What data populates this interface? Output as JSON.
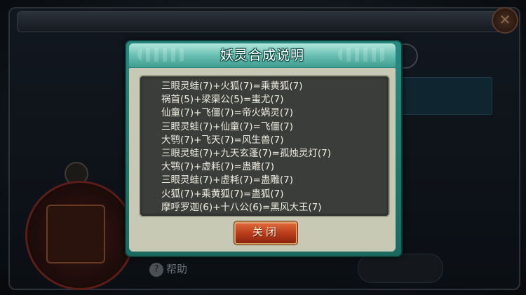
{
  "background": {
    "help_label": "帮助"
  },
  "dialog": {
    "title": "妖灵合成说明",
    "recipes": [
      "三眼灵蛙(7)+火狐(7)=乘黄狐(7)",
      "祸首(5)+梁渠公(5)=蚩尤(7)",
      "仙童(7)+飞僵(7)=帝火娲灵(7)",
      "三眼灵蛙(7)+仙童(7)=飞僵(7)",
      "大鹗(7)+飞天(7)=风生兽(7)",
      "三眼灵蛙(7)+九天玄蓬(7)=孤烛灵灯(7)",
      "大鹗(7)+虚耗(7)=蛊雕(7)",
      "三眼灵蛙(7)+虚耗(7)=蛊雕(7)",
      "火狐(7)+乘黄狐(7)=蛊狐(7)",
      "摩呼罗迦(6)+十八公(6)=黑风大王(7)"
    ],
    "close_label": "关闭"
  }
}
